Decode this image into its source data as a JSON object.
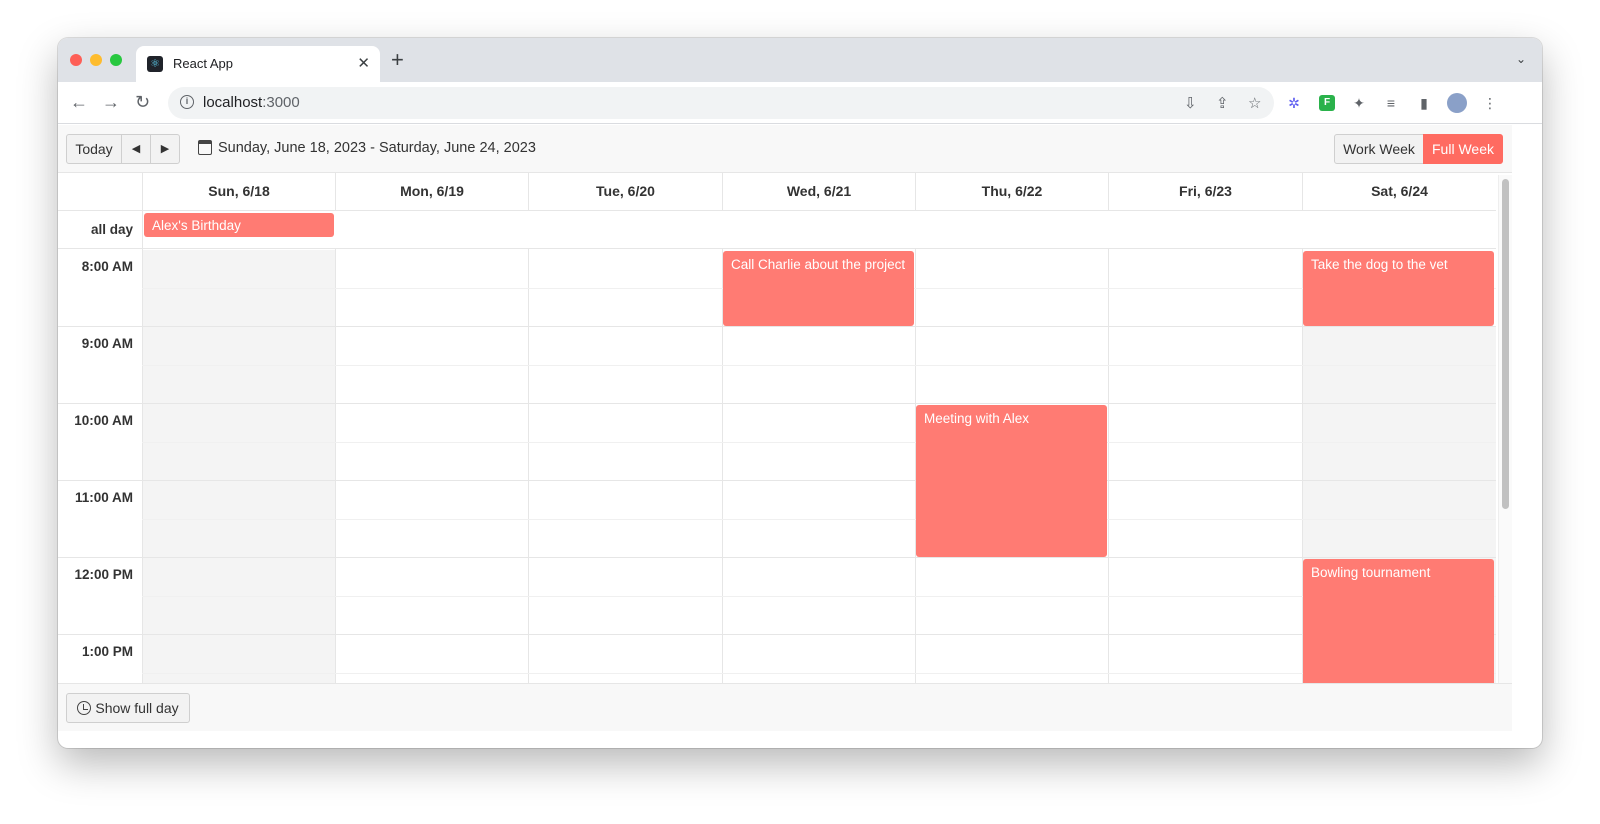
{
  "browser": {
    "tab_title": "React App",
    "tab_close": "✕",
    "new_tab": "+",
    "tabs_menu": "⌄",
    "url_host": "localhost",
    "url_port": ":3000",
    "icons": [
      "back-icon",
      "forward-icon",
      "reload-icon",
      "info-icon",
      "install-icon",
      "share-icon",
      "bookmark-star-icon",
      "extension-icon",
      "puzzle-icon",
      "media-icon",
      "sidepanel-icon",
      "avatar",
      "more-menu-icon"
    ]
  },
  "calendar": {
    "toolbar": {
      "today_label": "Today",
      "prev_label": "◀",
      "next_label": "▶",
      "date_range": "Sunday, June 18, 2023 - Saturday, June 24, 2023",
      "work_week_label": "Work Week",
      "full_week_label": "Full Week",
      "active_view": "Full Week"
    },
    "days": [
      "Sun, 6/18",
      "Mon, 6/19",
      "Tue, 6/20",
      "Wed, 6/21",
      "Thu, 6/22",
      "Fri, 6/23",
      "Sat, 6/24"
    ],
    "all_day_label": "all day",
    "time_labels": [
      "8:00 AM",
      "9:00 AM",
      "10:00 AM",
      "11:00 AM",
      "12:00 PM",
      "1:00 PM"
    ],
    "all_day_events": [
      {
        "title": "Alex's Birthday",
        "day": "Sun, 6/18"
      }
    ],
    "events": [
      {
        "title": "Call Charlie about the project",
        "day": "Wed, 6/21",
        "start": "8:00 AM",
        "end": "9:00 AM"
      },
      {
        "title": "Take the dog to the vet",
        "day": "Sat, 6/24",
        "start": "8:00 AM",
        "end": "9:00 AM"
      },
      {
        "title": "Meeting with Alex",
        "day": "Thu, 6/22",
        "start": "10:00 AM",
        "end": "12:00 PM"
      },
      {
        "title": "Bowling tournament",
        "day": "Sat, 6/24",
        "start": "12:00 PM"
      }
    ],
    "footer": {
      "show_full_day_label": "Show full day"
    },
    "colors": {
      "accent": "#ff6b61",
      "event": "#ff7b73",
      "non_working": "#f4f4f4"
    }
  }
}
